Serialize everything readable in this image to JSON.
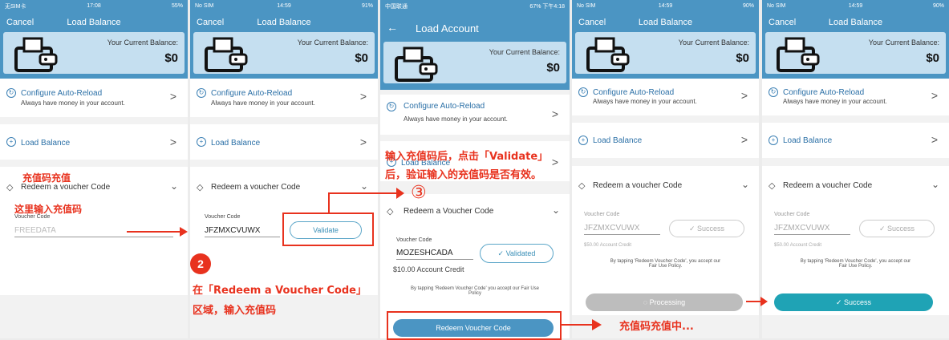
{
  "panels": [
    {
      "status": {
        "left": "无SIM卡",
        "time": "17:08",
        "right": "55%"
      },
      "nav": {
        "left": "Cancel",
        "title": "Load Balance"
      },
      "balance": {
        "label": "Your Current Balance:",
        "value": "$0"
      },
      "auto_reload": {
        "title": "Configure Auto-Reload",
        "subtitle": "Always have money in your account."
      },
      "load_balance": {
        "title": "Load Balance"
      },
      "redeem": {
        "title": "Redeem a voucher Code",
        "voucher_label": "Voucher Code",
        "voucher_placeholder": "FREEDATA"
      }
    },
    {
      "status": {
        "left": "No SIM",
        "time": "14:59",
        "right": "91%"
      },
      "nav": {
        "left": "Cancel",
        "title": "Load Balance"
      },
      "balance": {
        "label": "Your Current Balance:",
        "value": "$0"
      },
      "auto_reload": {
        "title": "Configure Auto-Reload",
        "subtitle": "Always have money in your account."
      },
      "load_balance": {
        "title": "Load Balance"
      },
      "redeem": {
        "title": "Redeem a voucher Code",
        "voucher_label": "Voucher Code",
        "voucher_value": "JFZMXCVUWX",
        "validate": "Validate"
      }
    },
    {
      "status": {
        "left": "中国联通",
        "time": "下午4:18",
        "right": "67%"
      },
      "nav": {
        "back": "←",
        "title": "Load Account"
      },
      "balance": {
        "label": "Your Current Balance:",
        "value": "$0"
      },
      "auto_reload": {
        "title": "Configure Auto-Reload",
        "subtitle": "Always have money in your account."
      },
      "load_balance": {
        "title": "Load Balance"
      },
      "redeem": {
        "title": "Redeem a Voucher Code",
        "voucher_label": "Voucher Code",
        "voucher_value": "MOZESHCADA",
        "credit": "$10.00 Account Credit",
        "validated": "Validated",
        "terms": "By tapping 'Redeem Voucher Code' you accept our Fair Use Policy",
        "button": "Redeem Voucher Code"
      }
    },
    {
      "status": {
        "left": "No SIM",
        "time": "14:59",
        "right": "90%"
      },
      "nav": {
        "left": "Cancel",
        "title": "Load Balance"
      },
      "balance": {
        "label": "Your Current Balance:",
        "value": "$0"
      },
      "auto_reload": {
        "title": "Configure Auto-Reload",
        "subtitle": "Always have money in your account."
      },
      "load_balance": {
        "title": "Load Balance"
      },
      "redeem": {
        "title": "Redeem a voucher Code",
        "voucher_label": "Voucher Code",
        "voucher_value": "JFZMXCVUWX",
        "credit": "$50.00 Account Credit",
        "success": "Success",
        "terms_1": "By tapping 'Redeem Voucher Code', you accept our",
        "terms_2": "Fair Use Policy.",
        "button": "Processing"
      }
    },
    {
      "status": {
        "left": "No SIM",
        "time": "14:59",
        "right": "90%"
      },
      "nav": {
        "left": "Cancel",
        "title": "Load Balance"
      },
      "balance": {
        "label": "Your Current Balance:",
        "value": "$0"
      },
      "auto_reload": {
        "title": "Configure Auto-Reload",
        "subtitle": "Always have money in your account."
      },
      "load_balance": {
        "title": "Load Balance"
      },
      "redeem": {
        "title": "Redeem a voucher Code",
        "voucher_label": "Voucher Code",
        "voucher_value": "JFZMXCVUWX",
        "credit": "$50.00 Account Credit",
        "success": "Success",
        "terms_1": "By tapping 'Redeem Voucher Code', you accept our",
        "terms_2": "Fair Use Policy.",
        "button": "Success"
      }
    }
  ],
  "annotations": {
    "voucher_recharge": "充值码充值",
    "enter_here": "这里输入充值码",
    "step2_num": "2",
    "step2_line1": "在「Redeem a Voucher Code」",
    "step2_line2": "区域，输入充值码",
    "step3_line1": "输入充值码后，点击「Validate」",
    "step3_line2": "后，验证输入的充值码是否有效。",
    "step3_num": "③",
    "recharging": "充值码充值中..."
  },
  "colors": {
    "header": "#4b95c3",
    "accent": "#e8321e",
    "success": "#1fa3b5",
    "processing": "#bdbdbd"
  }
}
